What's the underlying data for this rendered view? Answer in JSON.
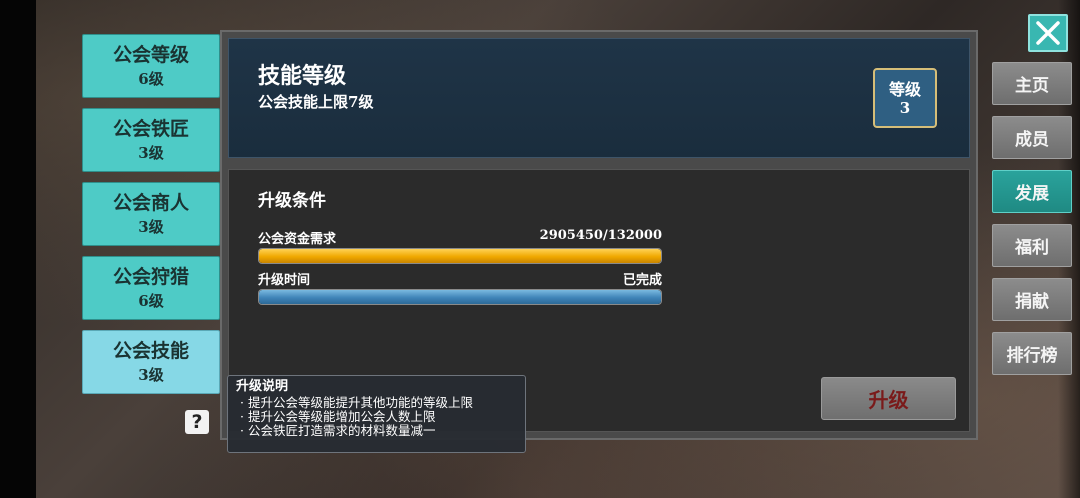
{
  "left_tabs": [
    {
      "label": "公会等级",
      "level": "6级",
      "active": false
    },
    {
      "label": "公会铁匠",
      "level": "3级",
      "active": false
    },
    {
      "label": "公会商人",
      "level": "3级",
      "active": false
    },
    {
      "label": "公会狩猎",
      "level": "6级",
      "active": false
    },
    {
      "label": "公会技能",
      "level": "3级",
      "active": true
    }
  ],
  "help_icon": {
    "glyph": "?"
  },
  "header": {
    "title": "技能等级",
    "subtitle": "公会技能上限7级",
    "badge_label": "等级",
    "badge_value": "3"
  },
  "conditions": {
    "title": "升级条件",
    "fund": {
      "label": "公会资金需求",
      "value": "2905450/132000",
      "progress": 1.0
    },
    "time": {
      "label": "升级时间",
      "value": "已完成",
      "progress": 1.0
    }
  },
  "upgrade_button": "升级",
  "tooltip": {
    "title": "升级说明",
    "lines": [
      "· 提升公会等级能提升其他功能的等级上限",
      "· 提升公会等级能增加公会人数上限",
      "· 公会铁匠打造需求的材料数量减一"
    ]
  },
  "nav": [
    {
      "label": "主页",
      "active": false
    },
    {
      "label": "成员",
      "active": false
    },
    {
      "label": "发展",
      "active": true
    },
    {
      "label": "福利",
      "active": false
    },
    {
      "label": "捐献",
      "active": false
    },
    {
      "label": "排行榜",
      "active": false
    }
  ],
  "colors": {
    "accent_teal": "#39b7b1",
    "tab_teal": "#4ecbc6",
    "tab_active": "#86d8e6",
    "bar_gold": "#f0a800",
    "bar_blue": "#3f84b8",
    "upgrade_text": "#7a1a1a"
  }
}
